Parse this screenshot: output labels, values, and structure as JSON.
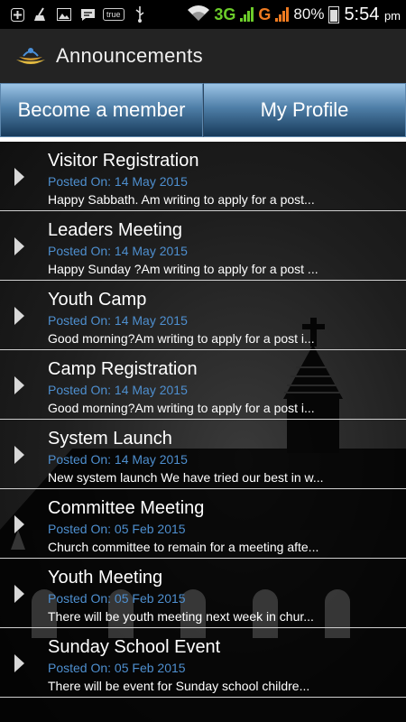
{
  "status_bar": {
    "network_label": "3G",
    "network2_label": "G",
    "battery_percent": "80%",
    "time": "5:54",
    "time_suffix": "pm",
    "true_label": "true",
    "icons": [
      "plus-icon",
      "broom-icon",
      "image-icon",
      "chat-icon",
      "true-icon",
      "usb-icon",
      "wifi-icon",
      "signal-icon",
      "battery-icon"
    ]
  },
  "action_bar": {
    "title": "Announcements",
    "logo_icon": "church-logo-icon"
  },
  "buttons": {
    "become_member": "Become a member",
    "my_profile": "My Profile"
  },
  "announcements": [
    {
      "title": "Visitor Registration",
      "posted": "Posted On: 14 May 2015",
      "excerpt": "Happy Sabbath. Am writing to apply for a post..."
    },
    {
      "title": "Leaders Meeting",
      "posted": "Posted On: 14 May 2015",
      "excerpt": "Happy Sunday ?Am writing to apply for a post ..."
    },
    {
      "title": "Youth Camp",
      "posted": "Posted On: 14 May 2015",
      "excerpt": "Good morning?Am writing to apply for a post i..."
    },
    {
      "title": "Camp Registration",
      "posted": "Posted On: 14 May 2015",
      "excerpt": "Good morning?Am writing to apply for a post i..."
    },
    {
      "title": "System Launch",
      "posted": "Posted On: 14 May 2015",
      "excerpt": "New system launch We have tried our best in w..."
    },
    {
      "title": "Committee Meeting",
      "posted": "Posted On: 05 Feb 2015",
      "excerpt": "Church committee to remain for a meeting afte..."
    },
    {
      "title": "Youth Meeting",
      "posted": "Posted On: 05 Feb 2015",
      "excerpt": "There will be youth meeting next week in chur..."
    },
    {
      "title": "Sunday School Event",
      "posted": "Posted On: 05 Feb 2015",
      "excerpt": "There will be event for Sunday school childre..."
    }
  ],
  "colors": {
    "accent_blue": "#4e8fcf",
    "button_gradient_top": "#9cc4e6",
    "button_gradient_bottom": "#173a5a",
    "network_3g": "#6ccc2a",
    "network_g": "#ee7a20"
  }
}
